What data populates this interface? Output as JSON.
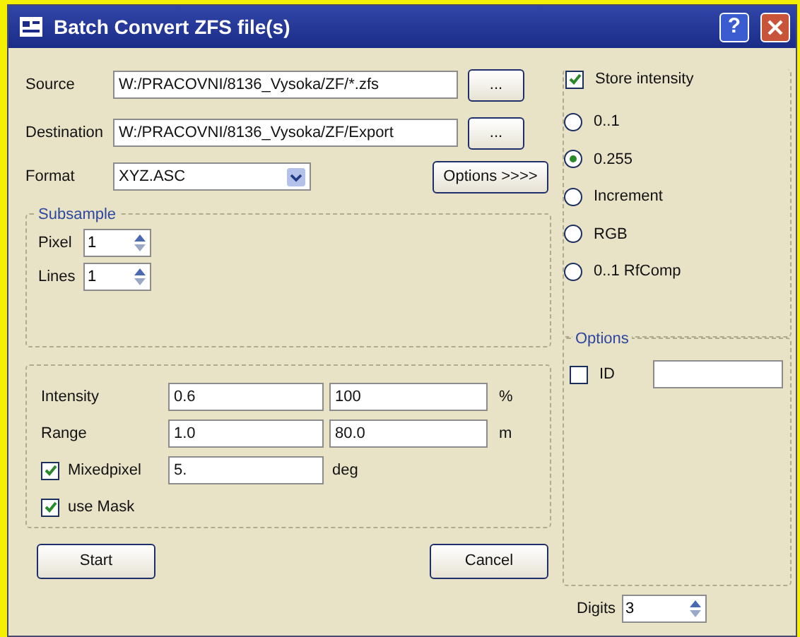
{
  "window": {
    "title": "Batch Convert ZFS file(s)",
    "help_button": "?"
  },
  "source": {
    "label": "Source",
    "value": "W:/PRACOVNI/8136_Vysoka/ZF/*.zfs",
    "button": "..."
  },
  "destination": {
    "label": "Destination",
    "value": "W:/PRACOVNI/8136_Vysoka/ZF/Export",
    "button": "..."
  },
  "format": {
    "label": "Format",
    "value": "XYZ.ASC"
  },
  "options_button": "Options >>>>",
  "subsample": {
    "title": "Subsample",
    "fields": [
      {
        "label": "Pixel",
        "value": "1"
      },
      {
        "label": "Lines",
        "value": "1"
      }
    ]
  },
  "parameters": [
    {
      "kind": "pair",
      "label": "Intensity",
      "value": "0.6",
      "value_2": "100",
      "unit": "%"
    },
    {
      "kind": "pair",
      "label": "Range",
      "value": "1.0",
      "value_2": "80.0",
      "unit": "m"
    },
    {
      "kind": "check",
      "label": "Mixedpixel",
      "checked": true,
      "value": "5.",
      "unit": "deg"
    },
    {
      "kind": "check",
      "label": "use Mask",
      "checked": true
    }
  ],
  "start_button": "Start",
  "cancel_button": "Cancel",
  "store_intensity": {
    "label": "Store intensity",
    "checked": true
  },
  "scales": [
    {
      "label": "0..1",
      "selected": false
    },
    {
      "label": "0.255",
      "selected": true
    },
    {
      "label": "Increment",
      "selected": false
    },
    {
      "label": "RGB",
      "selected": false
    },
    {
      "label": "0..1 RfComp",
      "selected": false
    }
  ],
  "options": {
    "title": "Options",
    "id": {
      "label": "ID",
      "checked": false
    }
  },
  "digits": {
    "label": "Digits",
    "value": "3"
  }
}
